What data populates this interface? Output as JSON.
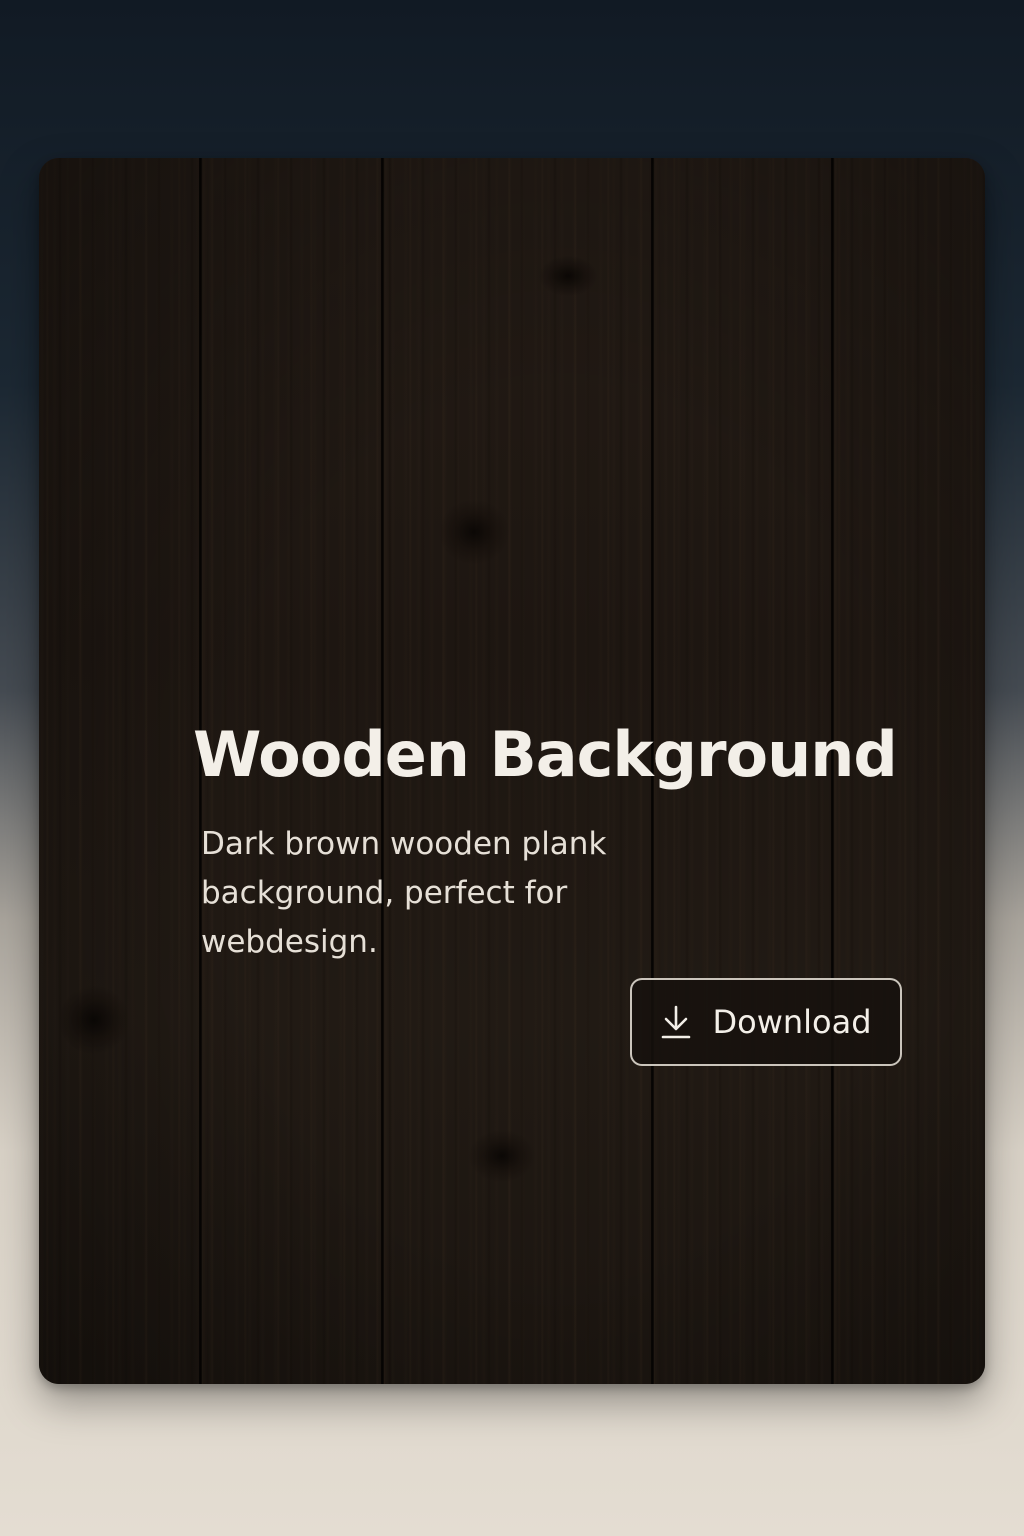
{
  "card": {
    "title": "Wooden Background",
    "description": "Dark brown wooden plank background, perfect for webdesign.",
    "download_label": "Download",
    "download_icon": "download-icon"
  },
  "colors": {
    "wood": "#1f1914",
    "text": "#f3efe8",
    "button_border": "#ebe5dc"
  }
}
